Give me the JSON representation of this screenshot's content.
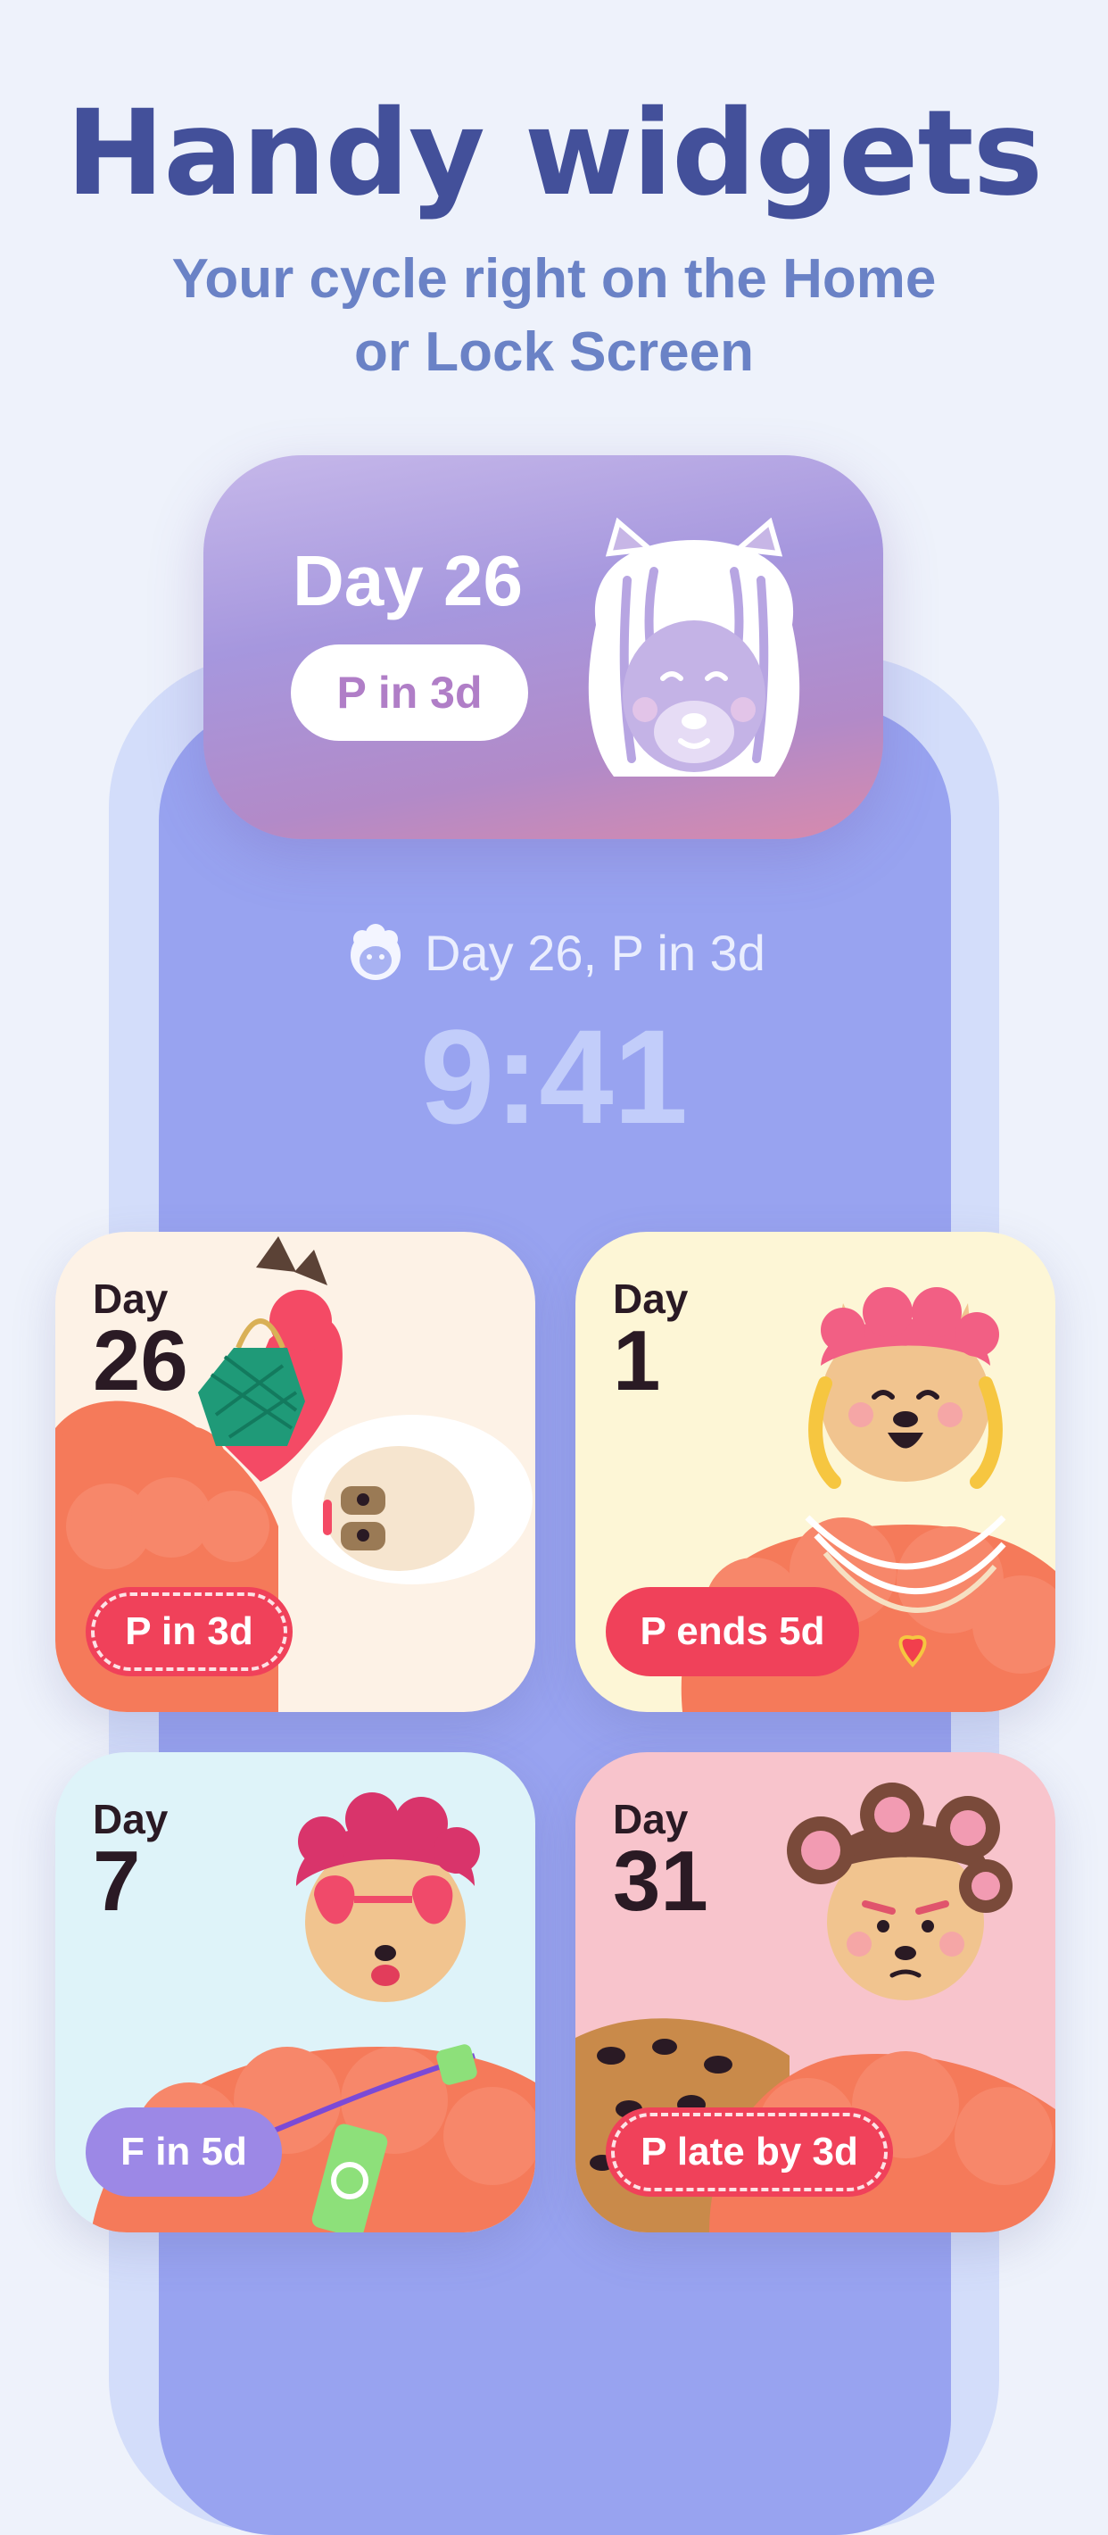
{
  "header": {
    "title": "Handy widgets",
    "subtitle_line1": "Your cycle right on the Home",
    "subtitle_line2": "or Lock Screen"
  },
  "top_widget": {
    "day": "Day 26",
    "pill": "P in 3d"
  },
  "lock_screen": {
    "status": "Day 26, P in 3d",
    "time": "9:41"
  },
  "cards": [
    {
      "day_label": "Day",
      "day_number": "26",
      "pill": "P in 3d",
      "pill_style": "dashed",
      "background": "#fdf2e6"
    },
    {
      "day_label": "Day",
      "day_number": "1",
      "pill": "P ends 5d",
      "pill_style": "solid",
      "background": "#fdf6d6"
    },
    {
      "day_label": "Day",
      "day_number": "7",
      "pill": "F in 5d",
      "pill_style": "purple",
      "background": "#def3f9"
    },
    {
      "day_label": "Day",
      "day_number": "31",
      "pill": "P late by 3d",
      "pill_style": "dashed",
      "background": "#f8c4cc"
    }
  ],
  "colors": {
    "title": "#43509a",
    "subtitle": "#6a82c6",
    "phone_body": "#98a3f0",
    "pill_red": "#f0415a",
    "pill_purple": "#9c88e6"
  },
  "icons": {
    "top_widget_art": "llama-face-outline-icon",
    "lock_screen_icon": "llama-head-icon"
  }
}
